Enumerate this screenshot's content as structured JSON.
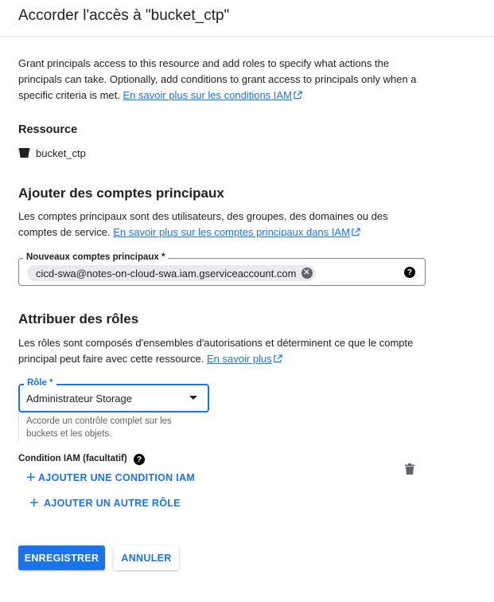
{
  "dialog": {
    "title": "Accorder l'accès à \"bucket_ctp\""
  },
  "intro": {
    "text": "Grant principals access to this resource and add roles to specify what actions the principals can take. Optionally, add conditions to grant access to principals only when a specific criteria is met. ",
    "link": "En savoir plus sur les conditions IAM"
  },
  "resource": {
    "heading": "Ressource",
    "name": "bucket_ctp",
    "icon": "bucket-icon"
  },
  "principals": {
    "heading": "Ajouter des comptes principaux",
    "description": "Les comptes principaux sont des utilisateurs, des groupes, des domaines ou des comptes de service. ",
    "link": "En savoir plus sur les comptes principaux dans IAM",
    "field_label": "Nouveaux comptes principaux *",
    "chips": [
      "cicd-swa@notes-on-cloud-swa.iam.gserviceaccount.com"
    ],
    "help_icon": "help-icon"
  },
  "roles": {
    "heading": "Attribuer des rôles",
    "description": "Les rôles sont composés d'ensembles d'autorisations et déterminent ce que le compte principal peut faire avec cette ressource. ",
    "link": "En savoir plus",
    "role_label": "Rôle *",
    "role_value": "Administrateur Storage",
    "role_helper": "Accorde un contrôle complet sur les buckets et les objets.",
    "condition_label": "Condition IAM (facultatif)",
    "add_condition_label": "AJOUTER UNE CONDITION IAM",
    "add_role_label": "AJOUTER UN AUTRE RÔLE"
  },
  "actions": {
    "save_label": "ENREGISTRER",
    "cancel_label": "ANNULER"
  },
  "colors": {
    "accent": "#1a73e8",
    "text": "#202124",
    "secondary_text": "#5f6368"
  }
}
